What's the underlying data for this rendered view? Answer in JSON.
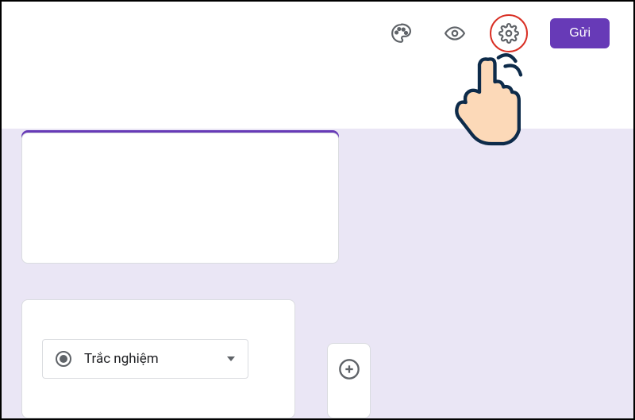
{
  "header": {
    "send_label": "Gửi",
    "icons": {
      "palette": "palette-icon",
      "preview": "eye-icon",
      "settings": "gear-icon"
    }
  },
  "question": {
    "type_label": "Trắc nghiệm"
  },
  "toolbar": {
    "add": "add-icon"
  },
  "colors": {
    "brand": "#673ab7",
    "highlight": "#d93025",
    "canvas": "#eae6f5"
  }
}
